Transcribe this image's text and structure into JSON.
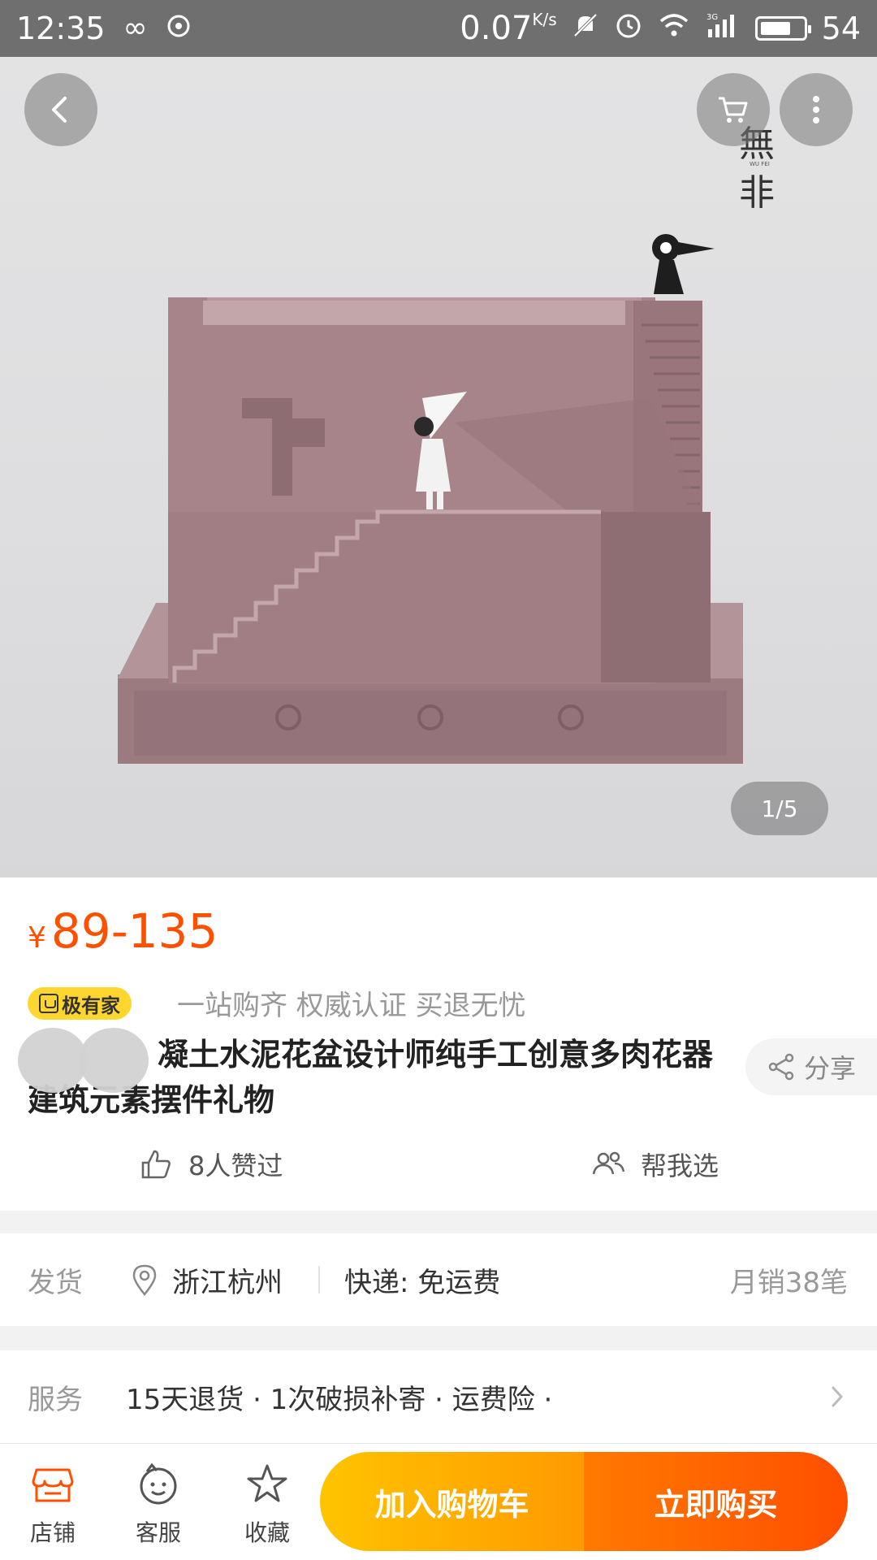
{
  "status_bar": {
    "time": "12:35",
    "speed_value": "0.07",
    "speed_unit": "K/s",
    "network": "3G",
    "battery": "54",
    "icons": [
      "infinity-icon",
      "sync-icon",
      "mute-icon",
      "alarm-icon",
      "wifi-icon",
      "signal-icon",
      "battery-icon"
    ]
  },
  "hero": {
    "page_indicator": "1/5",
    "brand_logo_text": "無 非",
    "brand_logo_sub": "WU FEI"
  },
  "product": {
    "currency": "¥",
    "price": "89-135",
    "badge": "极有家",
    "slogan": "一站购齐 权威认证 买退无忧",
    "title": "凝土水泥花盆设计师纯手工创意多肉花器建筑元素摆件礼物",
    "share_label": "分享",
    "likes_label": "8人赞过",
    "help_label": "帮我选"
  },
  "shipping": {
    "label": "发货",
    "location": "浙江杭州",
    "express": "快递: 免运费",
    "monthly_sales": "月销38笔"
  },
  "service": {
    "label": "服务",
    "items": "15天退货 · 1次破损补寄 · 运费险 ·"
  },
  "bottom_bar": {
    "shop": "店铺",
    "customer_service": "客服",
    "favorite": "收藏",
    "add_to_cart": "加入购物车",
    "buy_now": "立即购买"
  },
  "colors": {
    "accent": "#ff5000",
    "badge": "#ffd630",
    "cart_button": "#ffb000",
    "buy_button": "#ff5a00",
    "product_pink": "#a27f84"
  }
}
